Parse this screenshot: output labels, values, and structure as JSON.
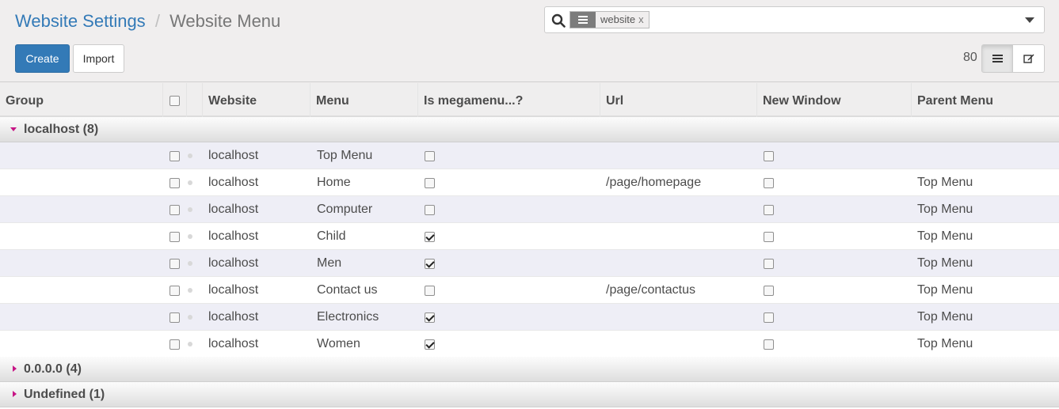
{
  "breadcrumb": {
    "parent": "Website Settings",
    "separator": "/",
    "current": "Website Menu"
  },
  "search": {
    "facet_value": "website",
    "facet_remove": "x",
    "placeholder": ""
  },
  "buttons": {
    "create": "Create",
    "import": "Import"
  },
  "pager": {
    "value": "80"
  },
  "table": {
    "headers": {
      "group": "Group",
      "website": "Website",
      "menu": "Menu",
      "is_megamenu": "Is megamenu...?",
      "url": "Url",
      "new_window": "New Window",
      "parent_menu": "Parent Menu"
    },
    "groups": [
      {
        "label": "localhost (8)",
        "expanded": true
      },
      {
        "label": "0.0.0.0 (4)",
        "expanded": false
      },
      {
        "label": "Undefined (1)",
        "expanded": false
      }
    ],
    "rows": [
      {
        "website": "localhost",
        "menu": "Top Menu",
        "megamenu": false,
        "url": "",
        "new_window": false,
        "parent": ""
      },
      {
        "website": "localhost",
        "menu": "Home",
        "megamenu": false,
        "url": "/page/homepage",
        "new_window": false,
        "parent": "Top Menu"
      },
      {
        "website": "localhost",
        "menu": "Computer",
        "megamenu": false,
        "url": "",
        "new_window": false,
        "parent": "Top Menu"
      },
      {
        "website": "localhost",
        "menu": "Child",
        "megamenu": true,
        "url": "",
        "new_window": false,
        "parent": "Top Menu"
      },
      {
        "website": "localhost",
        "menu": "Men",
        "megamenu": true,
        "url": "",
        "new_window": false,
        "parent": "Top Menu"
      },
      {
        "website": "localhost",
        "menu": "Contact us",
        "megamenu": false,
        "url": "/page/contactus",
        "new_window": false,
        "parent": "Top Menu"
      },
      {
        "website": "localhost",
        "menu": "Electronics",
        "megamenu": true,
        "url": "",
        "new_window": false,
        "parent": "Top Menu"
      },
      {
        "website": "localhost",
        "menu": "Women",
        "megamenu": true,
        "url": "",
        "new_window": false,
        "parent": "Top Menu"
      }
    ]
  },
  "colors": {
    "primary": "#337ab7",
    "group_caret": "#c71585",
    "odd_row": "#eeeef6"
  },
  "icons": {
    "search": "search-icon",
    "facet": "list-icon",
    "toggle": "caret-down-icon",
    "list_view": "list-view-icon",
    "form_view": "edit-icon"
  }
}
